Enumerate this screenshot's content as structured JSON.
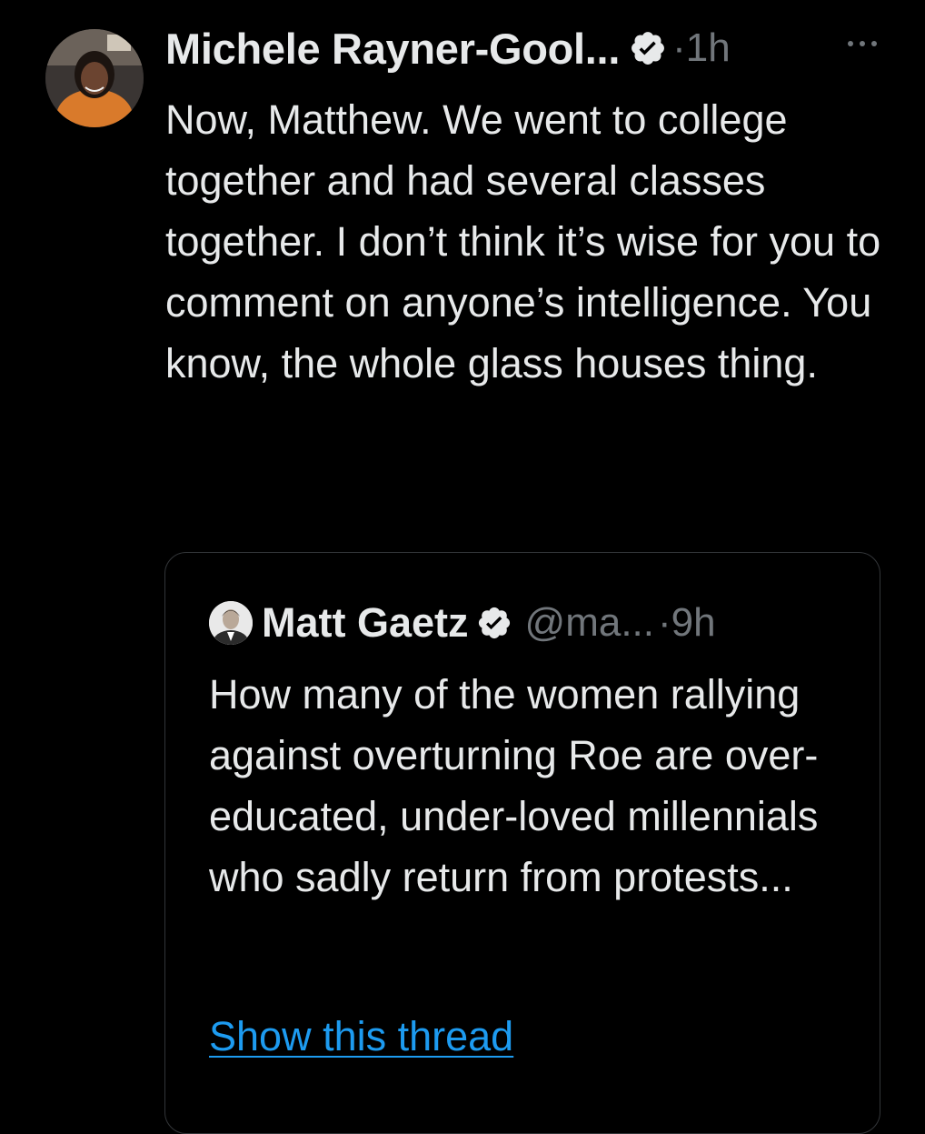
{
  "tweet": {
    "author_name": "Michele Rayner-Gool...",
    "separator": "·",
    "time": "1h",
    "more_label": "···",
    "text": "Now, Matthew. We went to college together and had several classes together. I don’t think it’s wise for you to comment on anyone’s intelligence. You know, the whole glass houses thing.",
    "avatar_icon": "profile-photo-icon",
    "verified_icon": "verified-badge-icon"
  },
  "quote": {
    "author_name": "Matt Gaetz",
    "handle": "@ma...",
    "separator": "·",
    "time": "9h",
    "text": "How many of the women rallying against overturning Roe are over-educated, under-loved millennials who sadly return from protests...",
    "show_thread_label": "Show this thread",
    "avatar_icon": "profile-photo-icon",
    "verified_icon": "verified-badge-icon"
  },
  "colors": {
    "background": "#000000",
    "primary_text": "#e7e9ea",
    "secondary_text": "#71767b",
    "link": "#1d9bf0",
    "card_border": "#333639"
  }
}
